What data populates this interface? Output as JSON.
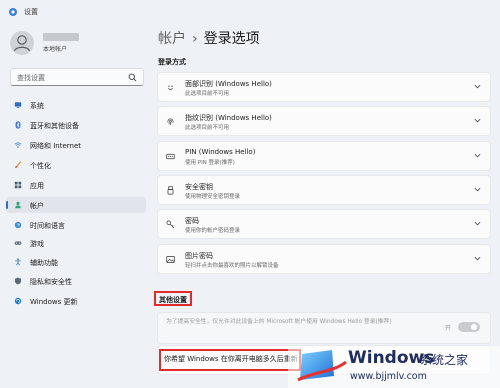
{
  "window": {
    "title": "设置"
  },
  "user": {
    "role": "本地帐户"
  },
  "search": {
    "placeholder": "查找设置"
  },
  "sidebar": {
    "items": [
      {
        "label": "系统",
        "icon": "monitor-icon"
      },
      {
        "label": "蓝牙和其他设备",
        "icon": "bluetooth-icon"
      },
      {
        "label": "网络和 Internet",
        "icon": "wifi-icon"
      },
      {
        "label": "个性化",
        "icon": "brush-icon"
      },
      {
        "label": "应用",
        "icon": "apps-icon"
      },
      {
        "label": "帐户",
        "icon": "person-icon",
        "active": true
      },
      {
        "label": "时间和语言",
        "icon": "globe-clock-icon"
      },
      {
        "label": "游戏",
        "icon": "gamepad-icon"
      },
      {
        "label": "辅助功能",
        "icon": "accessibility-icon"
      },
      {
        "label": "隐私和安全性",
        "icon": "shield-icon"
      },
      {
        "label": "Windows 更新",
        "icon": "update-icon"
      }
    ]
  },
  "breadcrumb": {
    "parent": "帐户",
    "separator": "›",
    "current": "登录选项"
  },
  "signin": {
    "heading": "登录方式",
    "options": [
      {
        "title": "面部识别 (Windows Hello)",
        "subtitle": "此选项目前不可用",
        "icon": "face-icon"
      },
      {
        "title": "指纹识别 (Windows Hello)",
        "subtitle": "此选项目前不可用",
        "icon": "fingerprint-icon"
      },
      {
        "title": "PIN (Windows Hello)",
        "subtitle": "使用 PIN 登录(推荐)",
        "icon": "pin-icon"
      },
      {
        "title": "安全密钥",
        "subtitle": "使用物理安全密钥登录",
        "icon": "usb-key-icon"
      },
      {
        "title": "密码",
        "subtitle": "使用你的帐户密码登录",
        "icon": "key-icon"
      },
      {
        "title": "图片密码",
        "subtitle": "轻扫并点击你最喜欢的照片以解锁设备",
        "icon": "picture-icon"
      }
    ]
  },
  "other": {
    "heading": "其他设置",
    "hello_only_text": "为了提高安全性，仅允许对此设备上的 Microsoft 帐户使用 Windows Hello 登录(推荐)",
    "toggle_label": "开",
    "away_text": "你希望 Windows 在你离开电脑多久后重新"
  },
  "watermark": {
    "title": "Windows",
    "subtitle": "系统之家",
    "url": "www.bjjmlv.com"
  },
  "colors": {
    "accent": "#2c6fd1",
    "highlight": "#e02c2c"
  }
}
